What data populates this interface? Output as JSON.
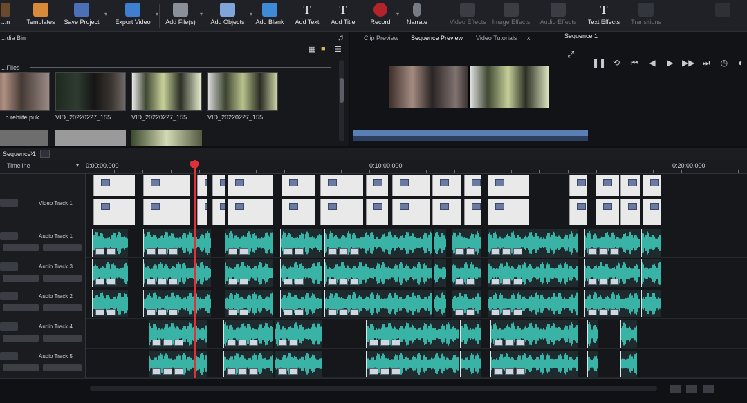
{
  "toolbar": {
    "items": [
      {
        "label": "...n",
        "icon": "export-icon",
        "left": 0
      },
      {
        "label": "Templates",
        "icon": "templates-icon"
      },
      {
        "label": "Save Project",
        "icon": "save-icon"
      },
      {
        "label": "Export Video",
        "icon": "export-video-icon"
      },
      {
        "label": "Add File(s)",
        "icon": "add-file-icon"
      },
      {
        "label": "Add Objects",
        "icon": "add-objects-icon"
      },
      {
        "label": "Add Blank",
        "icon": "add-blank-icon"
      },
      {
        "label": "Add Text",
        "icon": "add-text-icon"
      },
      {
        "label": "Add Title",
        "icon": "add-title-icon"
      },
      {
        "label": "Record",
        "icon": "record-icon"
      },
      {
        "label": "Narrate",
        "icon": "narrate-icon"
      },
      {
        "label": "Video Effects",
        "icon": "video-effects-icon"
      },
      {
        "label": "Image Effects",
        "icon": "image-effects-icon"
      },
      {
        "label": "Audio Effects",
        "icon": "audio-effects-icon"
      },
      {
        "label": "Text Effects",
        "icon": "text-effects-icon"
      },
      {
        "label": "Transitions",
        "icon": "transitions-icon"
      }
    ]
  },
  "media_bin": {
    "title": "...dia Bin",
    "subtitle": "...Files",
    "thumbnails": [
      "...p rebiite puk...",
      "VID_20220227_155...",
      "VID_20220227_155...",
      "VID_20220227_155..."
    ]
  },
  "preview": {
    "tabs": [
      "Clip Preview",
      "Sequence Preview",
      "Video Tutorials"
    ],
    "active_tab": "Sequence Preview",
    "tab_close": "x",
    "sequence_title": "Sequence 1"
  },
  "timeline": {
    "sequence_tab": "Sequence 1",
    "sequence_tab_close": "x",
    "view_select": "Timeline",
    "ruler_times": [
      "0:00:00.000",
      "0:10:00.000",
      "0:20:00.000"
    ],
    "tracks": [
      {
        "name": "Video Track 1"
      },
      {
        "name": "Audio Track 1"
      },
      {
        "name": "Audio Track 3"
      },
      {
        "name": "Audio Track 2"
      },
      {
        "name": "Audio Track 4"
      },
      {
        "name": "Audio Track 5"
      }
    ]
  },
  "colors": {
    "waveform": "#3fd6c4",
    "playhead": "#e0303a",
    "video_clip": "#e9e9ea",
    "toolbar_bg": "#1f2126"
  }
}
